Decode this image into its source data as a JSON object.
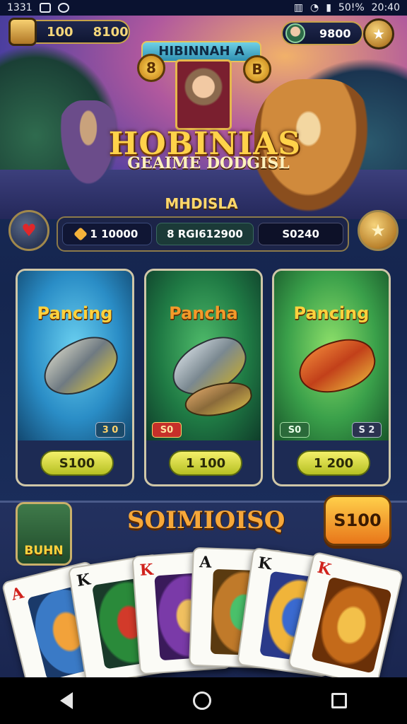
{
  "status_bar": {
    "time_left": "1331",
    "clock": "20:40",
    "battery": "50!%"
  },
  "hero": {
    "coins_label": "100",
    "coins_total": "8100",
    "player_score": "9800",
    "banner_text": "HIBINNAH A",
    "medal_left": "8",
    "medal_right": "B",
    "title": "HOBINIAS",
    "subtitle": "GEAIME DODGISL",
    "tagline": "MHDISLA"
  },
  "stats": {
    "stat_a": "1 10000",
    "stat_b": "8 RGI612900",
    "stat_c": "S0240"
  },
  "fishing_cards": [
    {
      "title": "Pancing",
      "badge": "3 0",
      "price": "S100"
    },
    {
      "title": "Pancha",
      "badge": "S0",
      "price": "1 100"
    },
    {
      "title": "Pancing",
      "badge_left": "S0",
      "badge_right": "S 2",
      "price": "1 200"
    }
  ],
  "bundle": {
    "icon_label": "BUHN",
    "title": "SOIMIOISQ",
    "price": "S100"
  },
  "playing_cards": [
    {
      "rank": "A",
      "suit": "♠",
      "color": "red"
    },
    {
      "rank": "K",
      "suit": "♠",
      "color": "black"
    },
    {
      "rank": "K",
      "suit": "♦",
      "color": "red"
    },
    {
      "rank": "A",
      "suit": "♠",
      "color": "black"
    },
    {
      "rank": "K",
      "suit": "♠",
      "color": "black"
    },
    {
      "rank": "K",
      "suit": "♥",
      "color": "red"
    }
  ],
  "icons": {
    "heart": "heart-icon",
    "star": "star-icon",
    "coin": "coin-stack-icon"
  },
  "colors": {
    "gold": "#ffd23d",
    "accent_orange": "#f6a83a",
    "panel": "#1c2448"
  }
}
